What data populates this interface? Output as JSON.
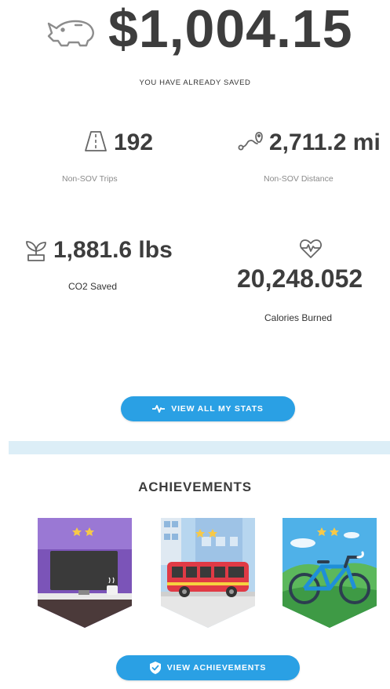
{
  "savings": {
    "amount": "$1,004.15",
    "label": "YOU HAVE ALREADY SAVED"
  },
  "stats": {
    "trips": {
      "value": "192",
      "label": "Non-SOV Trips",
      "icon": "road-icon"
    },
    "distance": {
      "value": "2,711.2 mi",
      "label": "Non-SOV Distance",
      "icon": "route-icon"
    },
    "co2": {
      "value": "1,881.6 lbs",
      "label": "CO2 Saved",
      "icon": "plant-icon"
    },
    "calories": {
      "value": "20,248.052",
      "label": "Calories Burned",
      "icon": "heartbeat-icon"
    }
  },
  "buttons": {
    "view_stats": "VIEW ALL MY STATS",
    "view_achievements": "VIEW ACHIEVEMENTS"
  },
  "achievements": {
    "title": "ACHIEVEMENTS",
    "badges": [
      "telework-badge",
      "transit-badge",
      "bike-badge"
    ]
  },
  "colors": {
    "accent": "#2aa0e4",
    "divider": "#dceef7",
    "text": "#3d3d3d"
  }
}
